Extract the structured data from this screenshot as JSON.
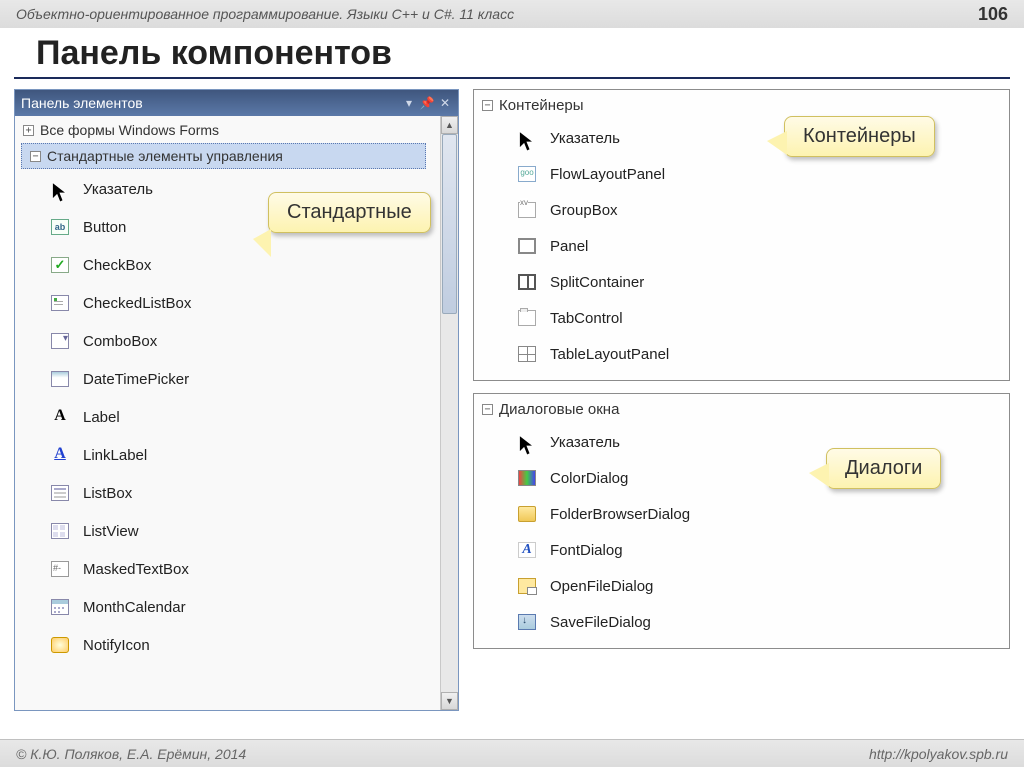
{
  "header": {
    "subject": "Объектно-ориентированное программирование. Языки C++ и C#. 11 класс",
    "page": "106"
  },
  "title": "Панель компонентов",
  "toolbox": {
    "title": "Панель элементов",
    "groups": {
      "allforms": "Все формы Windows Forms",
      "standard": "Стандартные элементы управления"
    },
    "items": [
      {
        "label": "Указатель",
        "icon": "pointer"
      },
      {
        "label": "Button",
        "icon": "ab"
      },
      {
        "label": "CheckBox",
        "icon": "check"
      },
      {
        "label": "CheckedListBox",
        "icon": "clb"
      },
      {
        "label": "ComboBox",
        "icon": "combo"
      },
      {
        "label": "DateTimePicker",
        "icon": "date"
      },
      {
        "label": "Label",
        "icon": "A"
      },
      {
        "label": "LinkLabel",
        "icon": "Au"
      },
      {
        "label": "ListBox",
        "icon": "listbox"
      },
      {
        "label": "ListView",
        "icon": "listview"
      },
      {
        "label": "MaskedTextBox",
        "icon": "masked"
      },
      {
        "label": "MonthCalendar",
        "icon": "month"
      },
      {
        "label": "NotifyIcon",
        "icon": "notify"
      }
    ]
  },
  "containers": {
    "title": "Контейнеры",
    "items": [
      {
        "label": "Указатель",
        "icon": "pointer"
      },
      {
        "label": "FlowLayoutPanel",
        "icon": "flow"
      },
      {
        "label": "GroupBox",
        "icon": "group"
      },
      {
        "label": "Panel",
        "icon": "panel"
      },
      {
        "label": "SplitContainer",
        "icon": "split"
      },
      {
        "label": "TabControl",
        "icon": "tab"
      },
      {
        "label": "TableLayoutPanel",
        "icon": "table"
      }
    ]
  },
  "dialogs": {
    "title": "Диалоговые окна",
    "items": [
      {
        "label": "Указатель",
        "icon": "pointer"
      },
      {
        "label": "ColorDialog",
        "icon": "color"
      },
      {
        "label": "FolderBrowserDialog",
        "icon": "folder"
      },
      {
        "label": "FontDialog",
        "icon": "font"
      },
      {
        "label": "OpenFileDialog",
        "icon": "open"
      },
      {
        "label": "SaveFileDialog",
        "icon": "save"
      }
    ]
  },
  "callouts": {
    "standard": "Стандартные",
    "containers": "Контейнеры",
    "dialogs": "Диалоги"
  },
  "footer": {
    "authors": "© К.Ю. Поляков, Е.А. Ерёмин, 2014",
    "url": "http://kpolyakov.spb.ru"
  }
}
